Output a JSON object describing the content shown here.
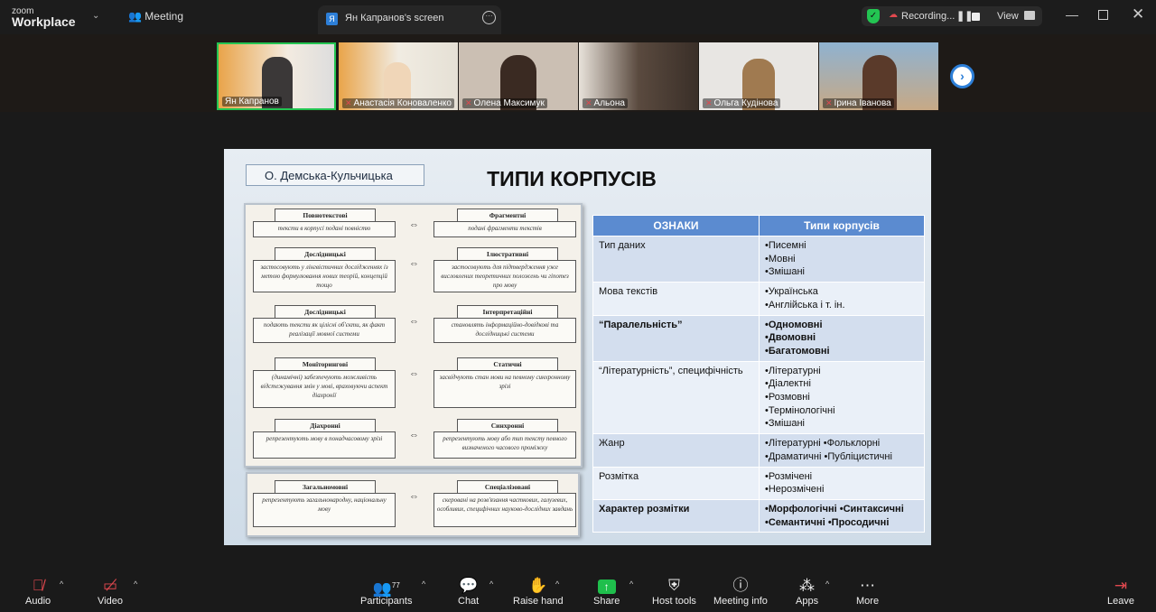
{
  "app": {
    "logo_small": "zoom",
    "logo_big": "Workplace",
    "meeting_tab": "Meeting",
    "screen_tab": "Ян Капранов's screen",
    "screen_tab_initial": "Я",
    "recording": "Recording...",
    "view": "View"
  },
  "participants": [
    {
      "name": "Ян Капранов",
      "muted": false,
      "active": true
    },
    {
      "name": "Анастасія Коноваленко",
      "muted": true
    },
    {
      "name": "Олена Максимук",
      "muted": true
    },
    {
      "name": "Альона",
      "muted": true
    },
    {
      "name": "Ольга Кудінова",
      "muted": true
    },
    {
      "name": "Ірина Іванова",
      "muted": true
    }
  ],
  "slide": {
    "author": "О. Демська-Кульчицька",
    "title": "ТИПИ КОРПУСІВ",
    "pairs": [
      {
        "l_head": "Повнотекстові",
        "l_body": "тексти в корпусі подані повністю",
        "r_head": "Фрагментні",
        "r_body": "подані фрагменти текстів"
      },
      {
        "l_head": "Дослідницькі",
        "l_body": "застосовують у лінгвістичних дослідженнях із метою формулювання нових теорій, концепцій тощо",
        "r_head": "Ілюстративні",
        "r_body": "застосовують для підтвердження уже висловлених теоретичних положень чи гіпотез про мову"
      },
      {
        "l_head": "Дослідницькі",
        "l_body": "подають тексти як цілісні об'єкти, як факт реалізації мовної системи",
        "r_head": "Інтерпретаційні",
        "r_body": "становлять інформаційно-довідкові та дослідницькі системи"
      },
      {
        "l_head": "Моніторингові",
        "l_body": "(динамічні) забезпечують можливість відстежування змін у мові, враховуючи аспект діахронії",
        "r_head": "Статичні",
        "r_body": "засвідчують стан мови на певному синхронному зрізі"
      },
      {
        "l_head": "Діахронні",
        "l_body": "репрезентують мову в понадчасовому зрізі",
        "r_head": "Синхронні",
        "r_body": "репрезентують мову або тип тексту певного визначеного часового проміжку"
      },
      {
        "l_head": "Загальномовні",
        "l_body": "репрезентують загальнонародну, національну мову",
        "r_head": "Спеціалізовані",
        "r_body": "скеровані на розв'язання часткових, галузевих, особливих, специфічних науково-дослідних завдань"
      }
    ],
    "arrow": "⇔",
    "table": {
      "headers": [
        "ОЗНАКИ",
        "Типи корпусів"
      ],
      "rows": [
        {
          "feature": "Тип даних",
          "types": "•Писемні\n•Мовні\n•Змішані",
          "bold": false
        },
        {
          "feature": "Мова текстів",
          "types": "•Українська\n•Англійська і т. ін.",
          "bold": false
        },
        {
          "feature": "“Паралельність”",
          "types": "•Одномовні\n•Двомовні\n•Багатомовні",
          "bold": true
        },
        {
          "feature": "“Літературність”, специфічність",
          "types": "•Літературні\n•Діалектні\n•Розмовні\n•Термінологічні\n•Змішані",
          "bold": false
        },
        {
          "feature": "Жанр",
          "types": "•Літературні •Фольклорні\n•Драматичні •Публіцистичні",
          "bold": false
        },
        {
          "feature": "Розмітка",
          "types": "•Розмічені\n•Нерозмічені",
          "bold": false
        },
        {
          "feature": "Характер розмітки",
          "types": "•Морфологічні •Синтаксичні\n•Семантичні •Просодичні",
          "bold": true
        }
      ]
    }
  },
  "toolbar": {
    "audio": "Audio",
    "video": "Video",
    "participants": "Participants",
    "participants_count": "77",
    "chat": "Chat",
    "raise_hand": "Raise hand",
    "share": "Share",
    "host_tools": "Host tools",
    "meeting_info": "Meeting info",
    "apps": "Apps",
    "more": "More",
    "leave": "Leave"
  },
  "colors": {
    "accent_green": "#23c552",
    "share_green": "#1fbf4c",
    "table_header": "#5b8bd0",
    "mute_red": "#e0484e"
  }
}
